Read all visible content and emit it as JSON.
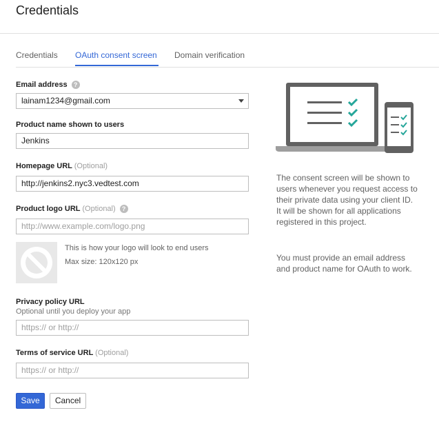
{
  "header": {
    "title": "Credentials"
  },
  "tabs": [
    {
      "label": "Credentials",
      "active": false
    },
    {
      "label": "OAuth consent screen",
      "active": true
    },
    {
      "label": "Domain verification",
      "active": false
    }
  ],
  "form": {
    "email": {
      "label": "Email address",
      "value": "lainam1234@gmail.com"
    },
    "product_name": {
      "label": "Product name shown to users",
      "value": "Jenkins"
    },
    "homepage": {
      "label": "Homepage URL",
      "optional": "(Optional)",
      "value": "http://jenkins2.nyc3.vedtest.com"
    },
    "logo": {
      "label": "Product logo URL",
      "optional": "(Optional)",
      "placeholder": "http://www.example.com/logo.png",
      "note_line1": "This is how your logo will look to end users",
      "note_line2": "Max size: 120x120 px"
    },
    "privacy": {
      "label": "Privacy policy URL",
      "sublabel": "Optional until you deploy your app",
      "placeholder": "https:// or http://"
    },
    "terms": {
      "label": "Terms of service URL",
      "optional": "(Optional)",
      "placeholder": "https:// or http://"
    }
  },
  "buttons": {
    "save": "Save",
    "cancel": "Cancel"
  },
  "info": {
    "paragraph1": "The consent screen will be shown to users whenever you request access to their private data using your client ID. It will be shown for all applications registered in this project.",
    "paragraph2": "You must provide an email address and product name for OAuth to work."
  },
  "colors": {
    "accent": "#3367d6",
    "check": "#26a69a",
    "device": "#616161"
  },
  "icons": {
    "help": "help-circle-icon",
    "dropdown": "chevron-down-icon",
    "logo_placeholder": "no-image-icon"
  }
}
